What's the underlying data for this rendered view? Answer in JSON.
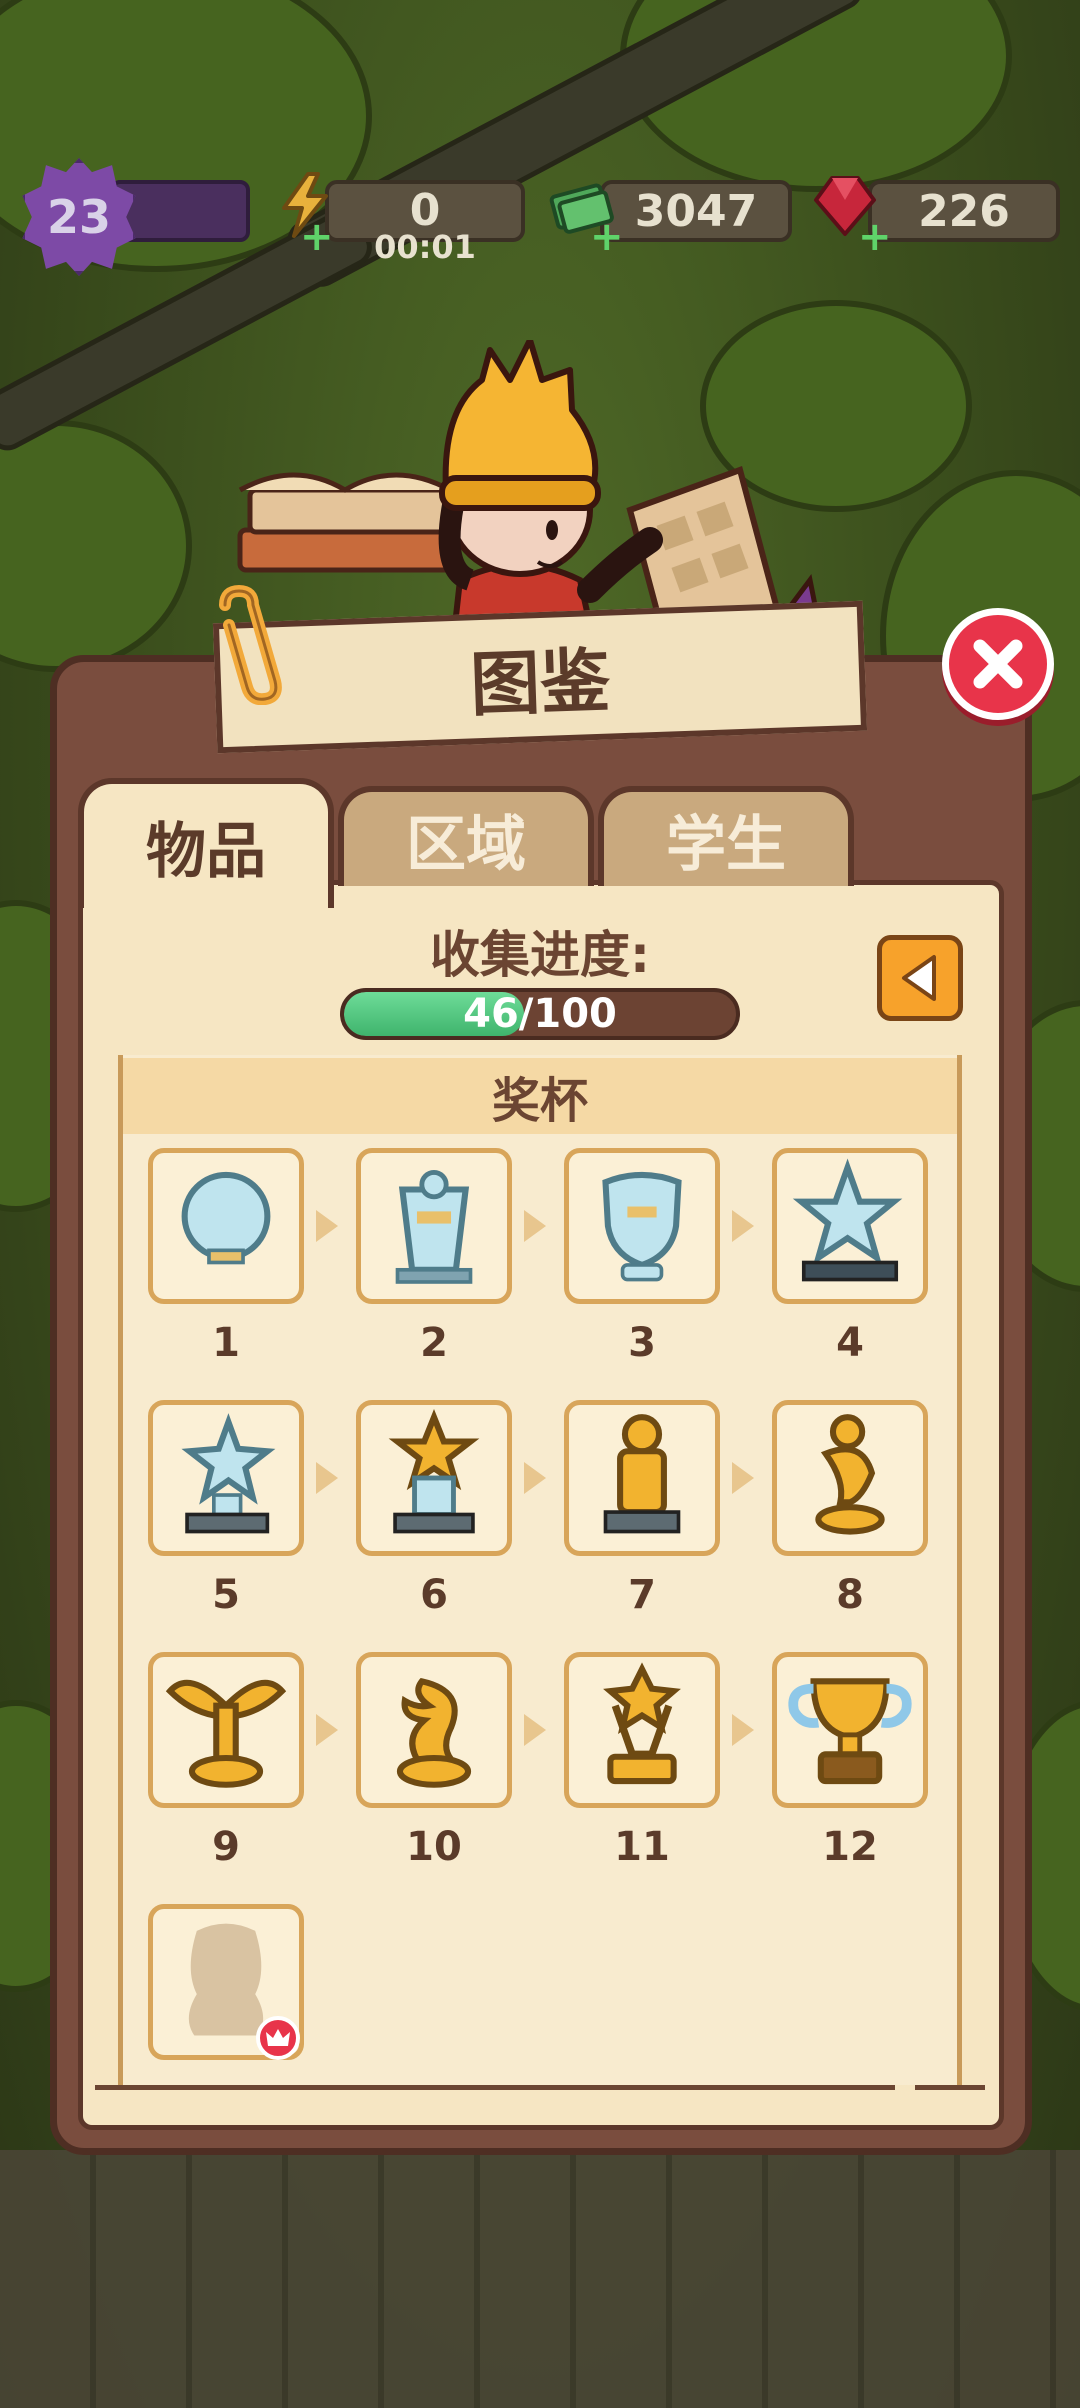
{
  "hud": {
    "level": "23",
    "energy": "0",
    "energy_timer": "00:01",
    "cash": "3047",
    "gems": "226"
  },
  "dialog": {
    "title": "图鉴",
    "tabs": [
      {
        "label": "物品",
        "active": true
      },
      {
        "label": "区域",
        "active": false
      },
      {
        "label": "学生",
        "active": false
      }
    ],
    "progress_label": "收集进度:",
    "progress_text": "46/100",
    "progress_fraction": 0.46,
    "category": "奖杯",
    "items": [
      {
        "number": "1",
        "icon": "glass-round-trophy-icon"
      },
      {
        "number": "2",
        "icon": "glass-plaque-trophy-icon"
      },
      {
        "number": "3",
        "icon": "glass-shield-trophy-icon"
      },
      {
        "number": "4",
        "icon": "glass-star-trophy-icon"
      },
      {
        "number": "5",
        "icon": "crystal-star-trophy-icon"
      },
      {
        "number": "6",
        "icon": "gold-star-trophy-icon"
      },
      {
        "number": "7",
        "icon": "gold-pillar-trophy-icon"
      },
      {
        "number": "8",
        "icon": "gold-figure-trophy-icon"
      },
      {
        "number": "9",
        "icon": "gold-winged-trophy-icon"
      },
      {
        "number": "10",
        "icon": "gold-flame-trophy-icon"
      },
      {
        "number": "11",
        "icon": "gold-star-cup-trophy-icon"
      },
      {
        "number": "12",
        "icon": "gold-cup-trophy-icon"
      },
      {
        "number": "",
        "icon": "locked-trophy-silhouette-icon"
      }
    ]
  },
  "colors": {
    "panel": "#7a4d3e",
    "paper": "#f6e6c3",
    "accent_green": "#3fb46d",
    "close_red": "#e8344a",
    "back_orange": "#f7a22b"
  }
}
